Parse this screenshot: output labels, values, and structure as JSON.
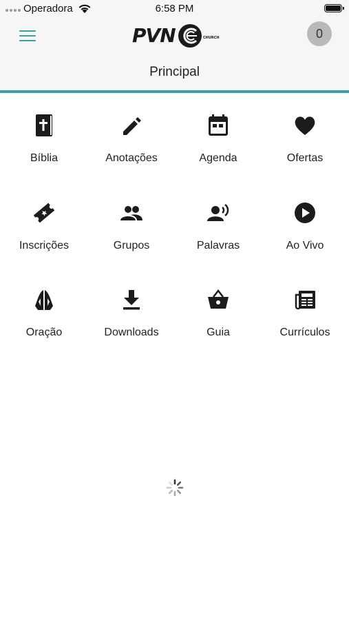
{
  "status_bar": {
    "carrier": "Operadora",
    "time": "6:58 PM"
  },
  "header": {
    "logo_text": "PVN",
    "logo_subtext": "CHURCH",
    "counter": "0",
    "title": "Principal",
    "accent_color": "#3a9fa6"
  },
  "menu": {
    "items": [
      {
        "label": "Bíblia",
        "icon": "bible-icon"
      },
      {
        "label": "Anotações",
        "icon": "pencil-icon"
      },
      {
        "label": "Agenda",
        "icon": "calendar-icon"
      },
      {
        "label": "Ofertas",
        "icon": "heart-icon"
      },
      {
        "label": "Inscrições",
        "icon": "ticket-icon"
      },
      {
        "label": "Grupos",
        "icon": "group-icon"
      },
      {
        "label": "Palavras",
        "icon": "speaker-icon"
      },
      {
        "label": "Ao Vivo",
        "icon": "play-icon"
      },
      {
        "label": "Oração",
        "icon": "praying-hands-icon"
      },
      {
        "label": "Downloads",
        "icon": "download-icon"
      },
      {
        "label": "Guia",
        "icon": "basket-icon"
      },
      {
        "label": "Currículos",
        "icon": "newspaper-icon"
      }
    ]
  },
  "loading": {
    "icon": "spinner-icon"
  }
}
